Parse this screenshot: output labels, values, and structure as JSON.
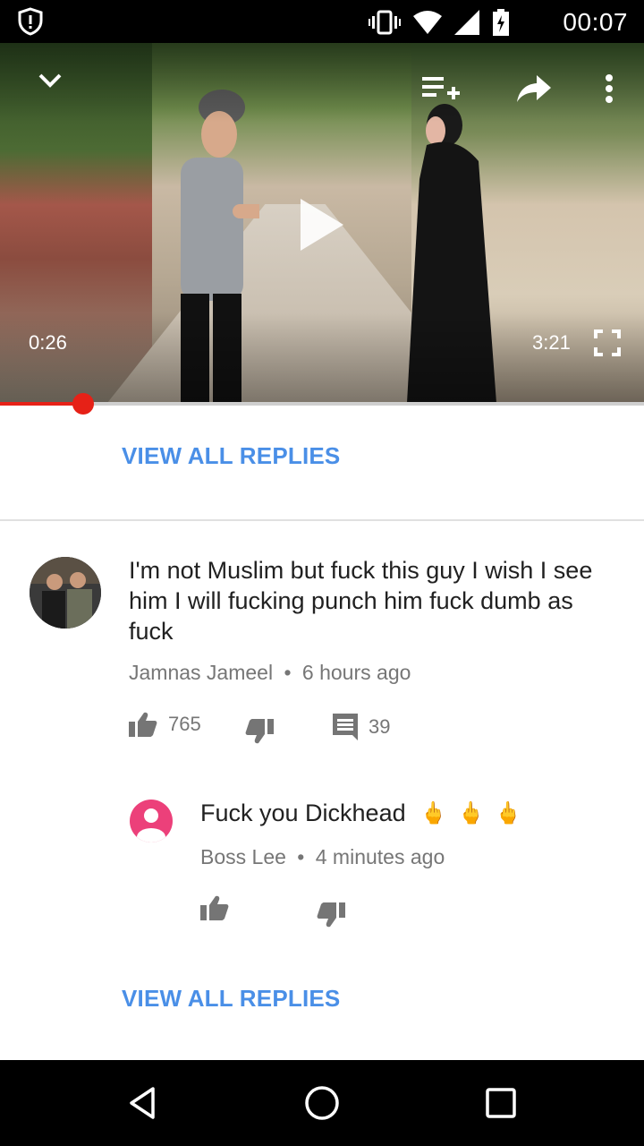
{
  "status_bar": {
    "time": "00:07"
  },
  "player": {
    "current_time": "0:26",
    "duration": "3:21",
    "progress": 0.129
  },
  "replies_top": {
    "label": "VIEW ALL REPLIES"
  },
  "comment": {
    "text": "I'm not Muslim but fuck this  guy I wish I see him I will fucking punch him fuck dumb as fuck",
    "author": "Jamnas Jameel",
    "separator": "•",
    "time": "6 hours ago",
    "likes": "765",
    "replies": "39"
  },
  "reply": {
    "text": "Fuck you Dickhead",
    "emoji": [
      "🖕",
      "🖕",
      "🖕"
    ],
    "author": "Boss Lee",
    "separator": "•",
    "time": "4 minutes ago"
  },
  "replies_bottom": {
    "label": "VIEW ALL REPLIES"
  },
  "colors": {
    "link": "#4a8fe7",
    "progress": "#e62117",
    "avatar_pink": "#ec407a"
  }
}
